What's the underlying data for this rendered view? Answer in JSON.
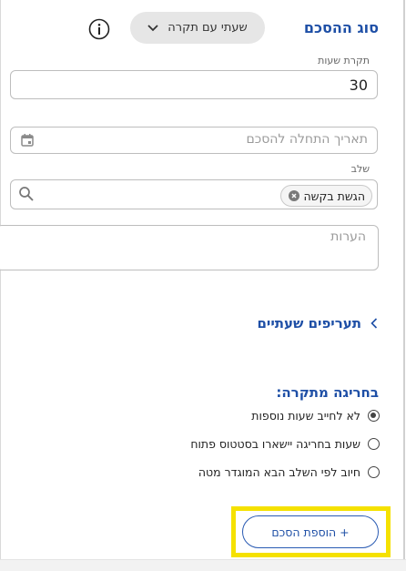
{
  "agreement_type": {
    "title": "סוג ההסכם",
    "selected": "שעתי עם תקרה"
  },
  "hours_cap": {
    "label": "תקרת שעות",
    "value": "30"
  },
  "start_date": {
    "placeholder": "תאריך התחלה להסכם"
  },
  "stage": {
    "label": "שלב",
    "chip": "הגשת בקשה"
  },
  "notes": {
    "placeholder": "הערות"
  },
  "hourly_rates": {
    "label": "תעריפים שעתיים"
  },
  "overflow": {
    "title": "בחריגה מתקרה:",
    "options": [
      {
        "label": "לא לחייב שעות נוספות",
        "checked": true
      },
      {
        "label": "שעות בחריגה יישארו בסטטוס פתוח",
        "checked": false
      },
      {
        "label": "חיוב לפי השלב הבא המוגדר מטה",
        "checked": false
      }
    ]
  },
  "add_button": {
    "label": "+ הוספת הסכם"
  },
  "colors": {
    "accent": "#1e4fa6",
    "highlight": "#f5e100"
  }
}
